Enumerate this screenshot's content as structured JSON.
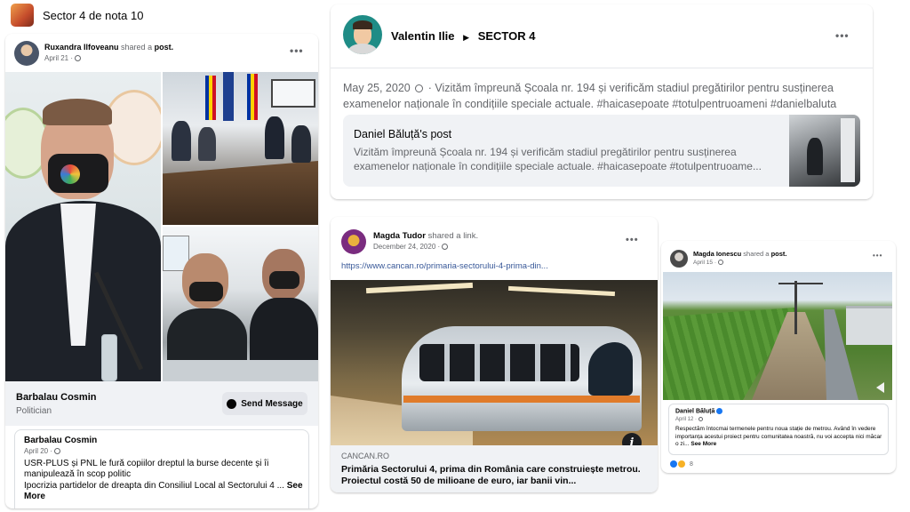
{
  "group": {
    "title": "Sector 4 de nota 10"
  },
  "post1": {
    "author": "Ruxandra Ilfoveanu",
    "action": "shared a",
    "action_object": "post.",
    "date": "April 21",
    "page_name": "Barbalau Cosmin",
    "page_category": "Politician",
    "send_message_label": "Send Message",
    "inner_author": "Barbalau Cosmin",
    "inner_date": "April 20",
    "inner_text_1": "USR-PLUS și PNL le fură copiilor dreptul la burse decente și îi manipulează în scop politic",
    "inner_text_2": "Ipocrizia partidelor de dreapta din Consiliul Local al Sectorului 4 ...",
    "see_more": "See More"
  },
  "post2": {
    "author": "Valentin Ilie",
    "separator": "▶",
    "target": "SECTOR 4",
    "date": "May 25, 2020",
    "text": "· Vizităm împreună Școala nr. 194 și verificăm stadiul pregătirilor pentru susținerea examenelor naționale în condițiile speciale actuale. #haicasepoate #totulpentruoameni #danielbaluta",
    "shared_title": "Daniel Băluță's post",
    "shared_text": "Vizităm împreună Școala nr. 194 și verificăm stadiul pregătirilor pentru susținerea examenelor naționale în condițiile speciale actuale. #haicasepoate #totulpentruoame..."
  },
  "post3": {
    "author": "Magda Tudor",
    "action": "shared a link.",
    "date": "December 24, 2020",
    "url": "https://www.cancan.ro/primaria-sectorului-4-prima-din...",
    "domain": "CANCAN.RO",
    "headline": "Primăria Sectorului 4, prima din România care construiește metrou. Proiectul costă 50 de milioane de euro, iar banii vin...",
    "info_icon": "i"
  },
  "post4": {
    "author": "Magda Ionescu",
    "action": "shared a",
    "action_object": "post.",
    "date": "April 15",
    "inner_author": "Daniel Băluță",
    "inner_date": "April 12",
    "inner_text": "Respectăm întocmai termenele pentru noua stație de metrou. Având în vedere importanța acestui proiect pentru comunitatea noastră, nu voi accepta nici măcar o zi...",
    "see_more": "See More",
    "reaction_count": "8"
  },
  "icons": [
    "group-avatar",
    "globe-icon",
    "messenger-icon",
    "more-options-icon",
    "verified-badge-icon",
    "info-icon",
    "play-triangle-icon",
    "like-reaction-icon",
    "haha-reaction-icon"
  ]
}
